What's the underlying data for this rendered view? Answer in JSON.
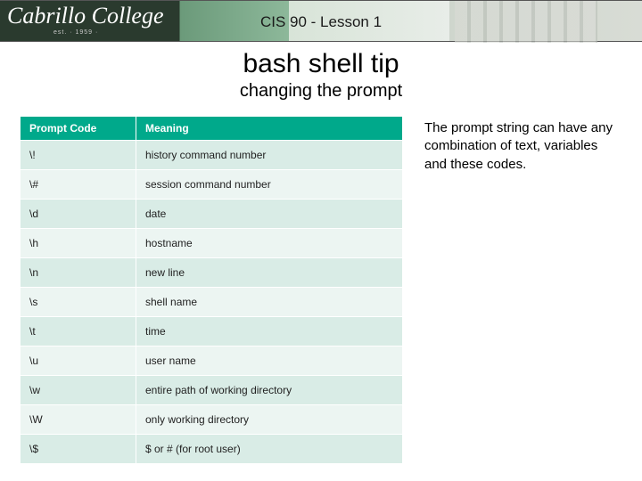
{
  "banner": {
    "logo": "Cabrillo College",
    "est": "est. · 1959 ·",
    "title": "CIS 90 - Lesson 1"
  },
  "slide": {
    "title": "bash shell tip",
    "subtitle": "changing the prompt"
  },
  "table": {
    "headers": {
      "code": "Prompt Code",
      "meaning": "Meaning"
    },
    "rows": [
      {
        "code": "\\!",
        "meaning": "history command number"
      },
      {
        "code": "\\#",
        "meaning": "session command number"
      },
      {
        "code": "\\d",
        "meaning": "date"
      },
      {
        "code": "\\h",
        "meaning": "hostname"
      },
      {
        "code": "\\n",
        "meaning": "new line"
      },
      {
        "code": "\\s",
        "meaning": "shell name"
      },
      {
        "code": "\\t",
        "meaning": "time"
      },
      {
        "code": "\\u",
        "meaning": "user name"
      },
      {
        "code": "\\w",
        "meaning": "entire path of working directory"
      },
      {
        "code": "\\W",
        "meaning": "only working directory"
      },
      {
        "code": "\\$",
        "meaning": "$ or # (for root user)"
      }
    ]
  },
  "sidenote": "The prompt string can have any combination of text, variables and these codes."
}
